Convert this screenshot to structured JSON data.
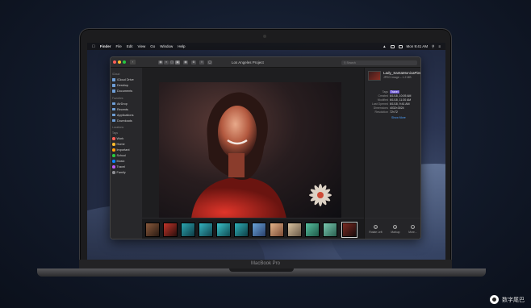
{
  "menubar": {
    "app": "Finder",
    "items": [
      "File",
      "Edit",
      "View",
      "Go",
      "Window",
      "Help"
    ],
    "clock": "Mon 9:41 AM"
  },
  "window": {
    "title": "Los Angeles Project",
    "search_placeholder": "Search"
  },
  "sidebar": {
    "sections": [
      {
        "heading": "iCloud",
        "items": [
          "iCloud Drive",
          "Desktop",
          "Documents"
        ]
      },
      {
        "heading": "Favorites",
        "items": [
          "AirDrop",
          "Recents",
          "Applications",
          "Downloads"
        ]
      },
      {
        "heading": "Locations",
        "items": []
      }
    ],
    "tags_heading": "Tags",
    "tags": [
      {
        "label": "Work",
        "color": "#ff5f57"
      },
      {
        "label": "Home",
        "color": "#febc2e"
      },
      {
        "label": "Important",
        "color": "#ff9f0a"
      },
      {
        "label": "School",
        "color": "#28c840"
      },
      {
        "label": "Music",
        "color": "#0a84ff"
      },
      {
        "label": "Travel",
        "color": "#bf5af2"
      },
      {
        "label": "Family",
        "color": "#8e8e93"
      }
    ]
  },
  "info": {
    "filename": "Lady_SantaMonicaPier.jpeg",
    "subtitle": "JPEG image – 1.2 MB",
    "meta": [
      {
        "key": "Tags",
        "value": "Travel",
        "badge": true
      },
      {
        "key": "Created",
        "value": "6/1/18, 10:05 AM"
      },
      {
        "key": "Modified",
        "value": "6/1/18, 11:30 AM"
      },
      {
        "key": "Last Opened",
        "value": "6/1/18, 9:41 AM"
      },
      {
        "key": "Dimensions",
        "value": "4032×3024"
      },
      {
        "key": "Resolution",
        "value": "72×72"
      }
    ],
    "show_more": "Show More",
    "actions": [
      "Rotate Left",
      "Markup",
      "More..."
    ]
  },
  "laptop_label": "MacBook Pro",
  "watermark": "数字尾巴",
  "colors": {
    "accent": "#4ea2ff",
    "tag_badge": "#6f5ad9"
  }
}
